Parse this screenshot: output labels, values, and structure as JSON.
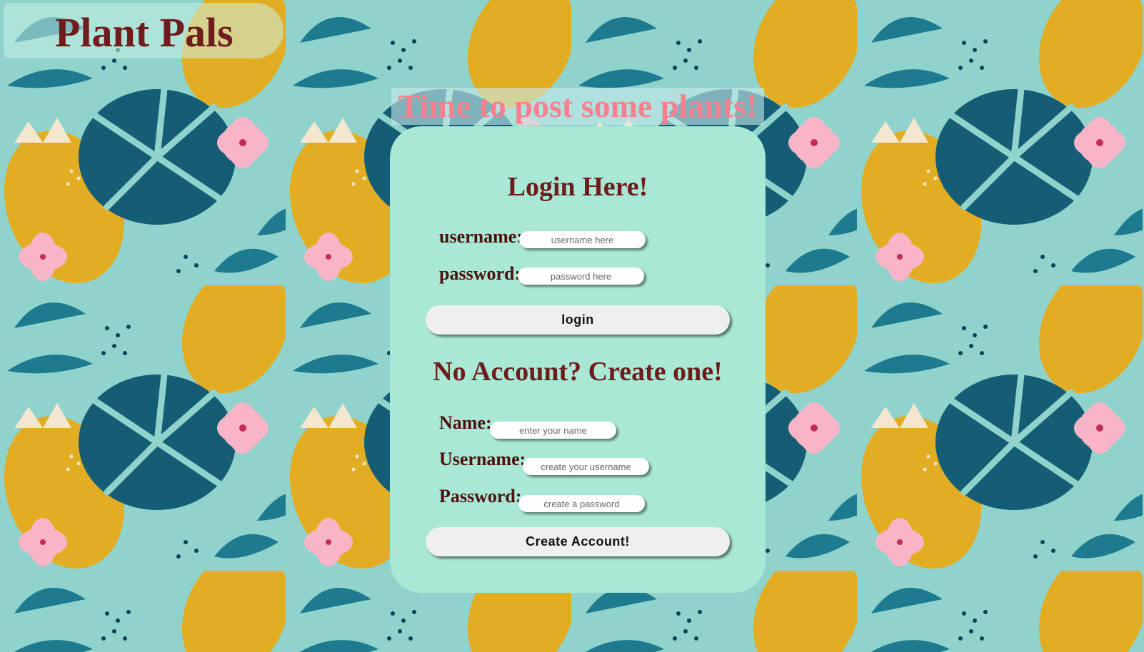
{
  "header": {
    "brand": "Plant Pals",
    "tagline": "Time to post some plants!"
  },
  "login": {
    "heading": "Login Here!",
    "username_label": "username:",
    "username_placeholder": "username here",
    "password_label": "password:",
    "password_placeholder": "password here",
    "button_label": "login"
  },
  "signup": {
    "heading": "No Account? Create one!",
    "name_label": "Name:",
    "name_placeholder": "enter your name",
    "username_label": "Username:",
    "username_placeholder": "create your username",
    "password_label": "Password:",
    "password_placeholder": "create a password",
    "button_label": "Create Account!"
  },
  "colors": {
    "background": "#8fd3cc",
    "card": "#a8e8d5",
    "heading_text": "#6e1c1c",
    "tagline_text": "#f6808e",
    "leaf_dark": "#145d74",
    "leaf_yellow": "#e2ad22",
    "flower_pink": "#f8b5c8"
  },
  "background_decor": [
    "monstera-leaf-icon",
    "palm-frond-icon",
    "hibiscus-flower-icon",
    "yellow-blob-icon"
  ]
}
